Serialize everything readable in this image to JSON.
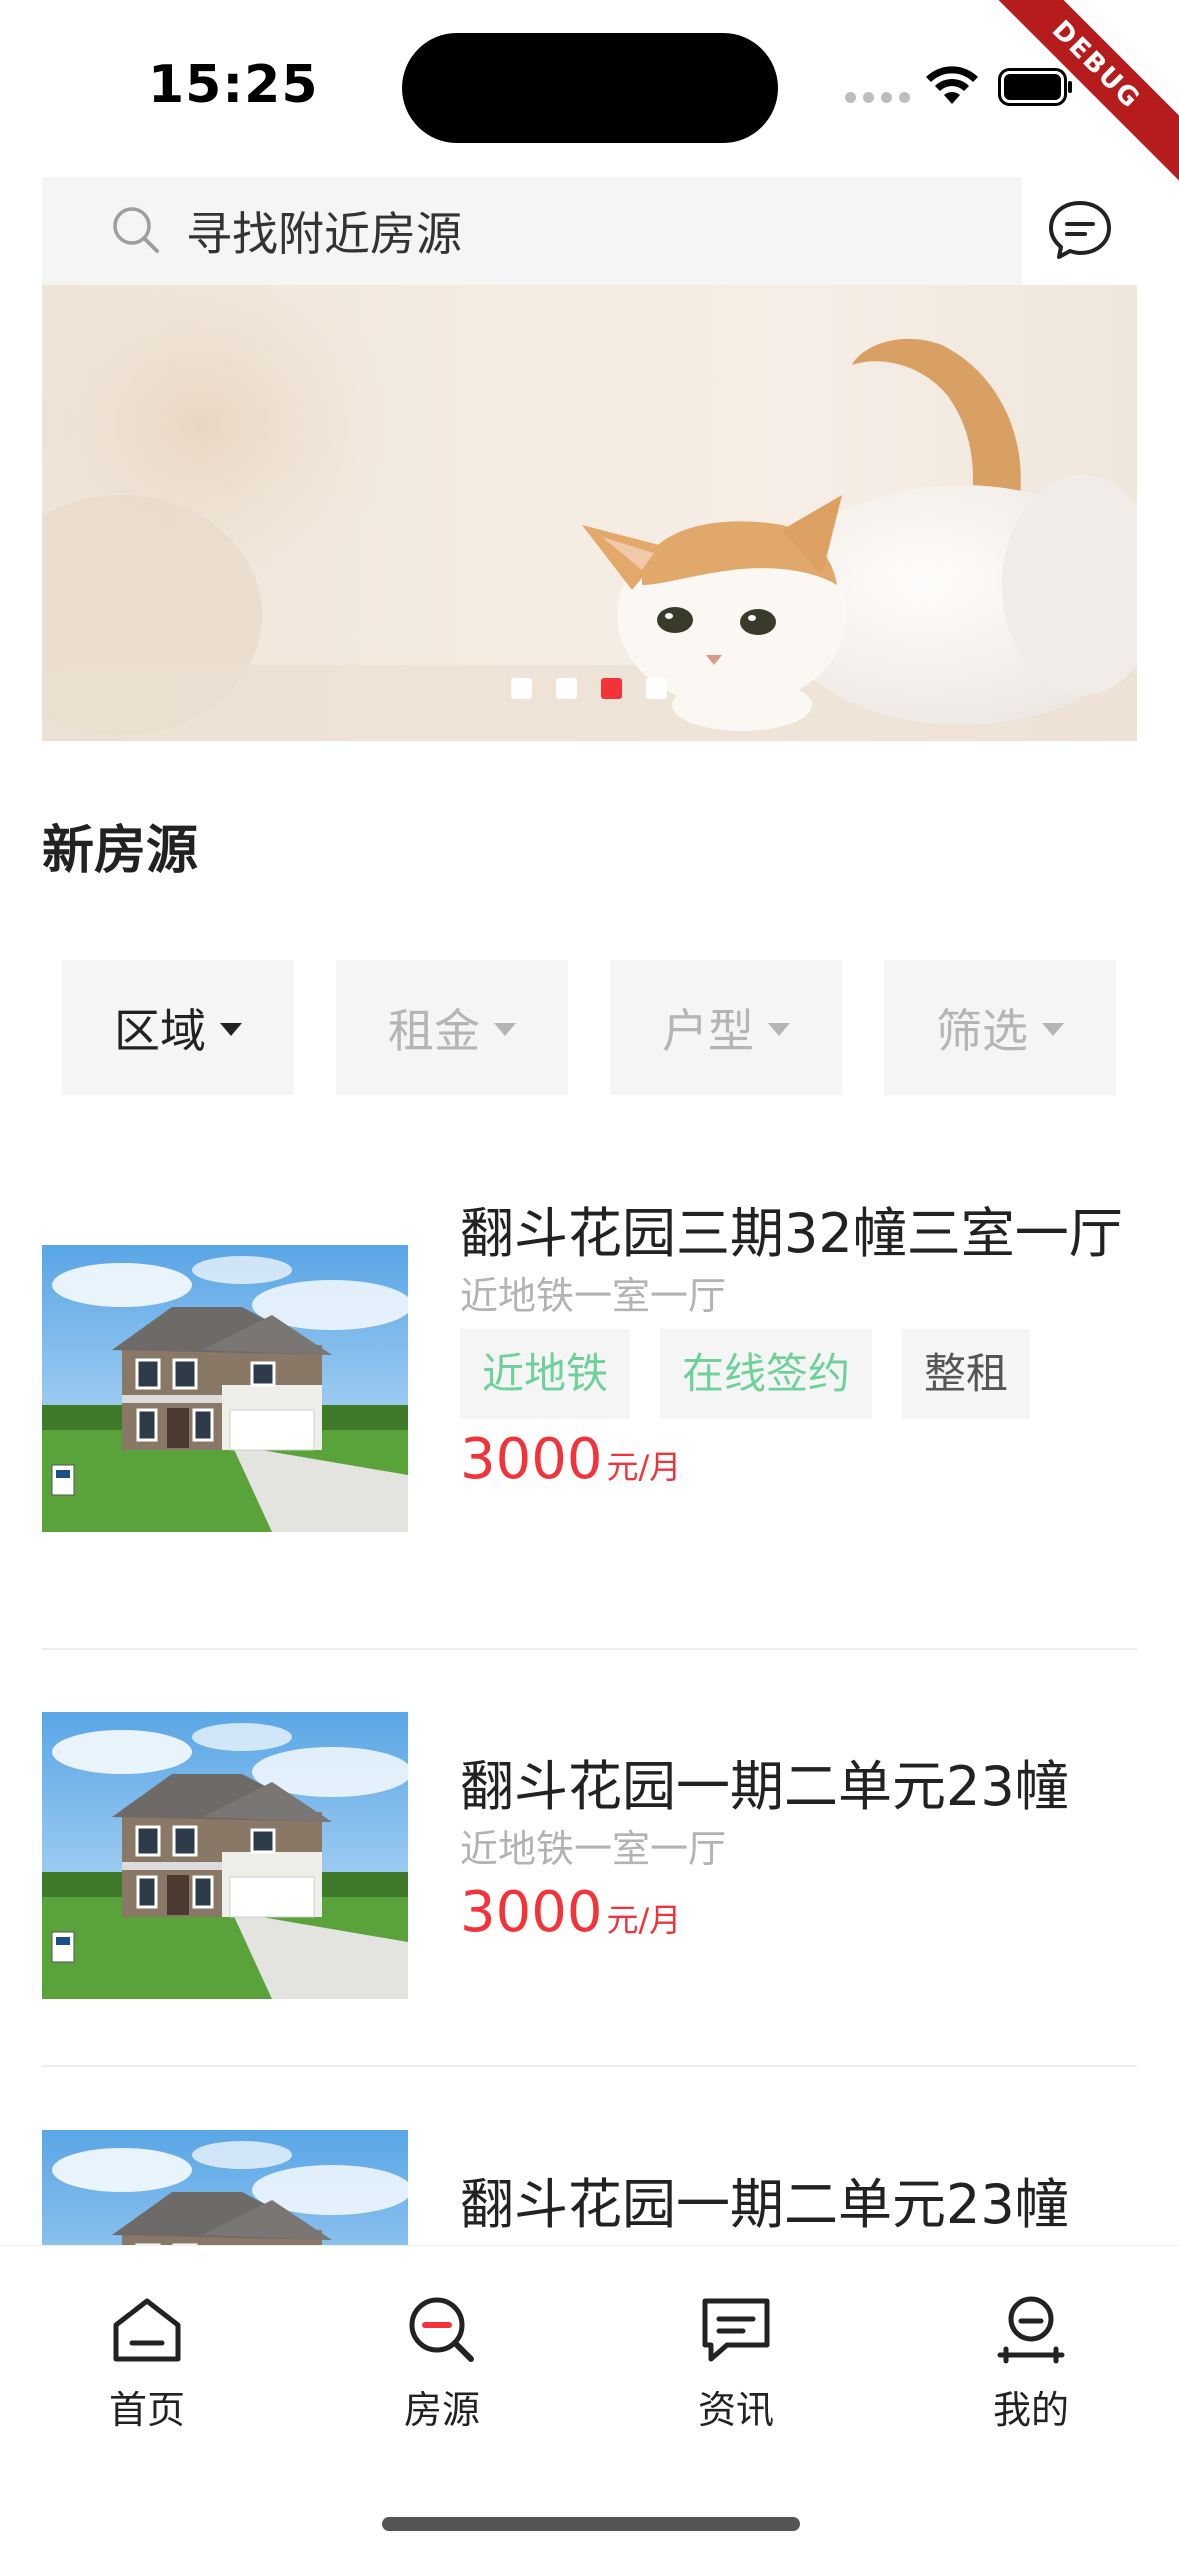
{
  "status_bar": {
    "time": "15:25",
    "debug_label": "DEBUG"
  },
  "search": {
    "placeholder": "寻找附近房源"
  },
  "banner": {
    "dots": [
      false,
      false,
      true,
      false
    ]
  },
  "section": {
    "title": "新房源"
  },
  "filters": [
    {
      "label": "区域",
      "active": true
    },
    {
      "label": "租金",
      "active": false
    },
    {
      "label": "户型",
      "active": false
    },
    {
      "label": "筛选",
      "active": false
    }
  ],
  "listings": [
    {
      "title": "翻斗花园三期32幢三室一厅",
      "subtitle": "近地铁一室一厅",
      "tags": [
        {
          "label": "近地铁",
          "color": "#6fd19a"
        },
        {
          "label": "在线签约",
          "color": "#6fd19a"
        },
        {
          "label": "整租",
          "color": "#555555"
        }
      ],
      "price": "3000",
      "price_unit": "元/月"
    },
    {
      "title": "翻斗花园一期二单元23幢",
      "subtitle": "近地铁一室一厅",
      "tags": [],
      "price": "3000",
      "price_unit": "元/月"
    },
    {
      "title": "翻斗花园一期二单元23幢",
      "subtitle": "",
      "tags": [],
      "price": "",
      "price_unit": ""
    }
  ],
  "bottom_nav": [
    {
      "label": "首页",
      "icon": "home-icon"
    },
    {
      "label": "房源",
      "icon": "house-search-icon"
    },
    {
      "label": "资讯",
      "icon": "news-icon"
    },
    {
      "label": "我的",
      "icon": "profile-icon"
    }
  ],
  "colors": {
    "accent": "#f2343a",
    "tag_green": "#6fd19a",
    "muted": "#b3b3b3"
  }
}
